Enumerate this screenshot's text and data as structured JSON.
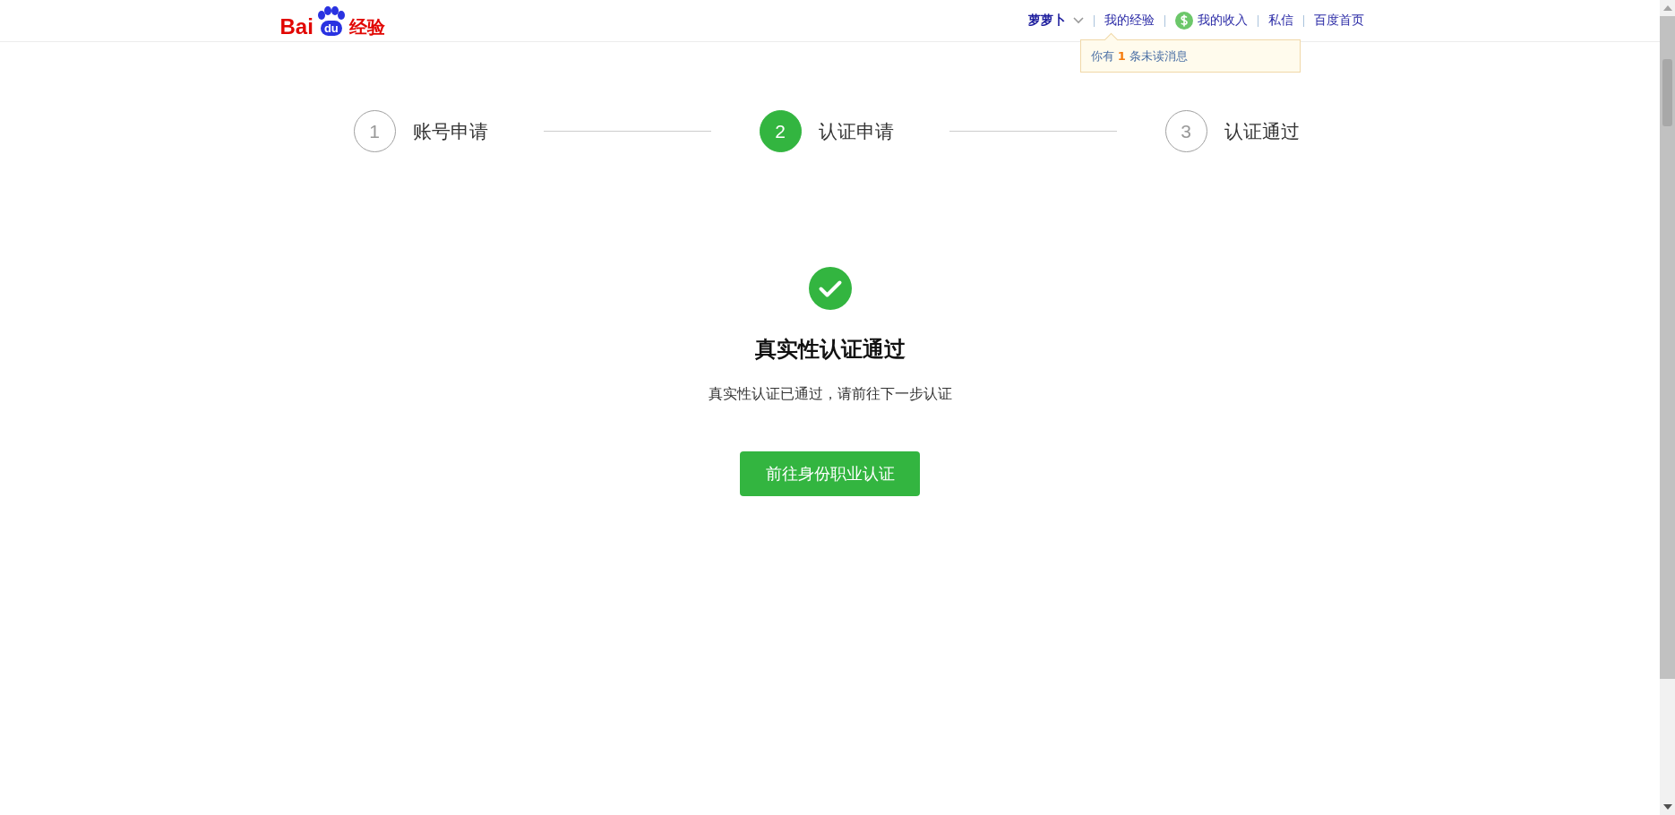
{
  "header": {
    "logo": {
      "part_1": "Bai",
      "part_2": "du",
      "part_3": "经验"
    },
    "user": {
      "name": "萝萝卜"
    },
    "nav": [
      {
        "label": "我的经验",
        "kind": "link"
      },
      {
        "label": "我的收入",
        "kind": "income"
      },
      {
        "label": "私信",
        "kind": "link"
      },
      {
        "label": "百度首页",
        "kind": "link"
      }
    ],
    "notice": {
      "before": "你有",
      "count": "1",
      "after": "条未读消息"
    }
  },
  "steps": [
    {
      "number": "1",
      "label": "账号申请",
      "selected": false
    },
    {
      "number": "2",
      "label": "认证申请",
      "selected": true
    },
    {
      "number": "3",
      "label": "认证通过",
      "selected": false
    }
  ],
  "result": {
    "title": "真实性认证通过",
    "message": "真实性认证已通过，请前往下一步认证",
    "button": "前往身份职业认证"
  }
}
